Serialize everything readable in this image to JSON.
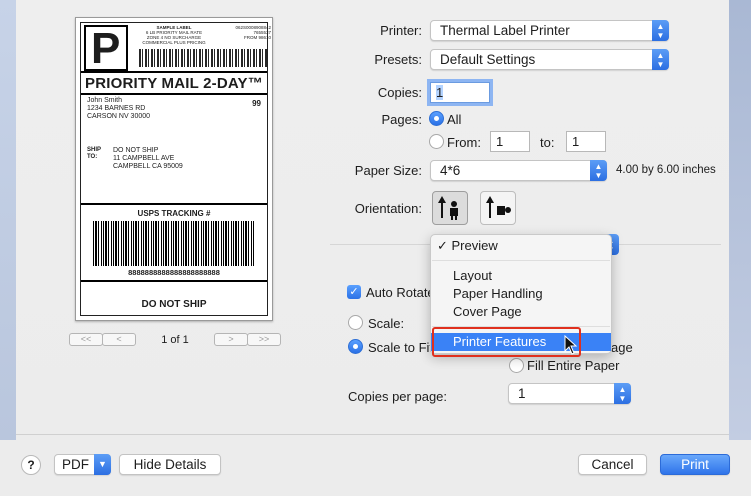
{
  "label": {
    "big_letter": "P",
    "sample_lines": [
      "SAMPLE LABEL",
      "6 LB PRIORITY MAIL RATE",
      "ZONE 4 NO SURCHARGE",
      "COMMERCIAL PLUS PRICING"
    ],
    "code_lines": [
      "062S0008908842",
      "7655537",
      "FROM 98610"
    ],
    "service": "PRIORITY MAIL 2-DAY™",
    "from_lines": [
      "John Smith",
      "1234 BARNES RD",
      "CARSON NV 30000"
    ],
    "number_99": "99",
    "ship_to_label": "SHIP\nTO:",
    "to_lines": [
      "DO NOT SHIP",
      "11 CAMPBELL AVE",
      "CAMPBELL CA 95009"
    ],
    "tracking_title": "USPS TRACKING #",
    "tracking_number": "8888888888888888888888",
    "footer": "DO NOT SHIP"
  },
  "pager": {
    "first": "<<",
    "prev": "<",
    "next": ">",
    "last": ">>",
    "status": "1 of 1"
  },
  "form": {
    "printer_label": "Printer:",
    "printer_value": "Thermal Label Printer",
    "presets_label": "Presets:",
    "presets_value": "Default Settings",
    "copies_label": "Copies:",
    "copies_value": "1",
    "pages_label": "Pages:",
    "pages_all": "All",
    "pages_from": "From:",
    "pages_from_value": "1",
    "pages_to": "to:",
    "pages_to_value": "1",
    "paper_label": "Paper Size:",
    "paper_value": "4*6",
    "paper_dims": "4.00 by 6.00 inches",
    "orientation_label": "Orientation:",
    "auto_rotate": "Auto Rotate",
    "scale": "Scale:",
    "scale_to_fit": "Scale to Fit",
    "scale_to_fit_tail": "age",
    "fill_entire": "Fill Entire Paper",
    "copies_per_page_label": "Copies per page:",
    "copies_per_page_value": "1"
  },
  "menu": {
    "items": [
      "✓ Preview",
      "Layout",
      "Paper Handling",
      "Cover Page",
      "Printer Features"
    ],
    "highlighted": "Printer Features"
  },
  "bottom": {
    "help": "?",
    "pdf": "PDF",
    "hide_details": "Hide Details",
    "cancel": "Cancel",
    "print": "Print"
  },
  "colors": {
    "accent": "#3a82f6",
    "callout": "#e0301e"
  }
}
